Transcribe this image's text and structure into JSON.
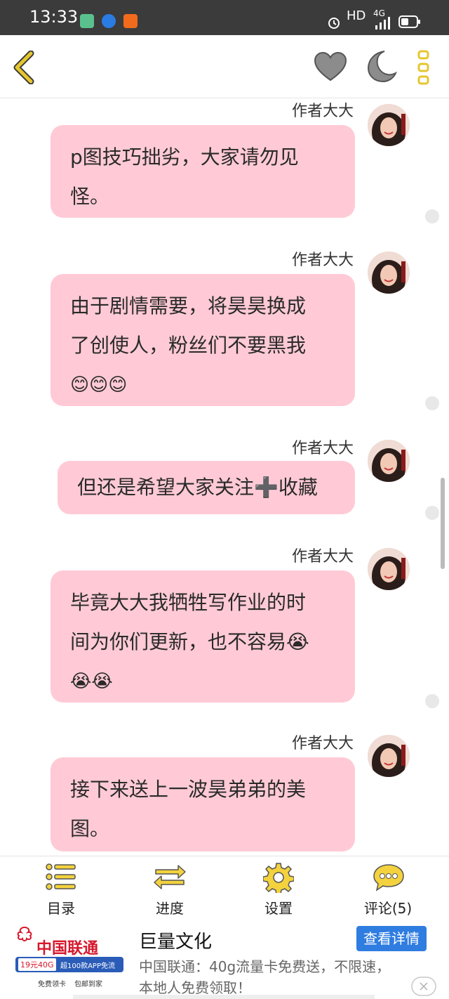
{
  "status": {
    "time": "13:33",
    "network_label": "HD",
    "signal_label": "4G"
  },
  "topbar": {
    "back_icon": "chevron-left-icon",
    "like_icon": "heart-icon",
    "night_icon": "moon-icon",
    "more_icon": "more-vertical-icon",
    "accent": "#e6c62e"
  },
  "messages": [
    {
      "author": "作者大大",
      "lines": [
        "p图技巧拙劣，大家请勿见",
        "怪。"
      ]
    },
    {
      "author": "作者大大",
      "lines": [
        "由于剧情需要，将昊昊换成",
        "了创使人，粉丝们不要黑我",
        "😊😊😊"
      ]
    },
    {
      "author": "作者大大",
      "lines": [
        "但还是希望大家关注➕收藏"
      ]
    },
    {
      "author": "作者大大",
      "lines": [
        "毕竟大大我牺牲写作业的时",
        "间为你们更新，也不容易😭",
        "😭😭"
      ]
    },
    {
      "author": "作者大大",
      "lines": [
        "接下来送上一波昊弟弟的美",
        "图。"
      ]
    }
  ],
  "bottom_nav": [
    {
      "label": "目录",
      "icon": "list-icon"
    },
    {
      "label": "进度",
      "icon": "swap-arrows-icon"
    },
    {
      "label": "设置",
      "icon": "gear-icon"
    },
    {
      "label": "评论(5)",
      "icon": "comment-icon"
    }
  ],
  "ad": {
    "logo_brand": "中国联通",
    "logo_promo": "19元40G",
    "logo_promo2": "超100款APP免流",
    "logo_foot1": "免费领卡",
    "logo_foot2": "包邮到家",
    "title": "巨量文化",
    "button": "查看详情",
    "desc_line1": "中国联通：40g流量卡免费送，不限速，",
    "desc_line2": "本地人免费领取！",
    "button_color": "#2f7de1"
  }
}
